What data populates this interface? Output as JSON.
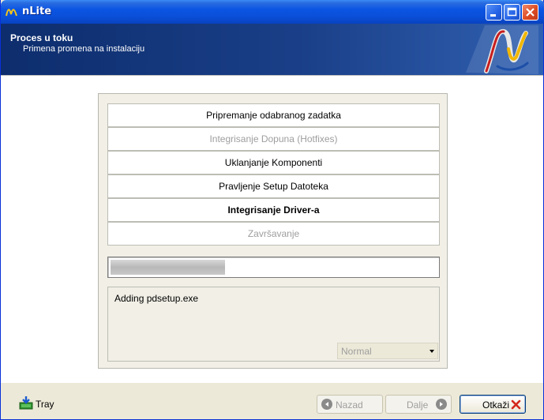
{
  "window": {
    "title": "nLite",
    "colors": {
      "titlebar": "#0b55e3",
      "header": "#1a3f88",
      "close": "#dd4b22"
    }
  },
  "header": {
    "title": "Proces u toku",
    "subtitle": "Primena promena na instalaciju",
    "logo_icon": "nlite-logo-icon"
  },
  "tasks": [
    {
      "label": "Pripremanje odabranog zadatka",
      "state": "done"
    },
    {
      "label": "Integrisanje Dopuna (Hotfixes)",
      "state": "skipped"
    },
    {
      "label": "Uklanjanje Komponenti",
      "state": "done"
    },
    {
      "label": "Pravljenje Setup Datoteka",
      "state": "done"
    },
    {
      "label": "Integrisanje Driver-a",
      "state": "current"
    },
    {
      "label": "Završavanje",
      "state": "pending"
    }
  ],
  "progress": {
    "percent": 35
  },
  "log": {
    "text": "Adding pdsetup.exe",
    "priority_select": {
      "value": "Normal"
    }
  },
  "footer": {
    "tray_label": "Tray",
    "back_label": "Nazad",
    "next_label": "Dalje",
    "cancel_label": "Otkaži"
  }
}
